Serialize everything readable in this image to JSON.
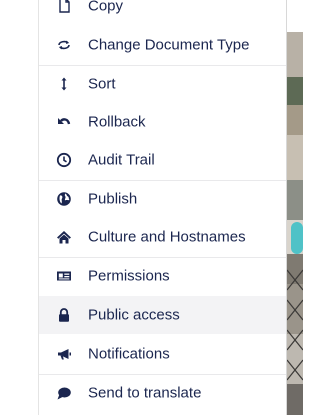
{
  "menu": {
    "items": [
      {
        "label": "Copy",
        "icon": "copy-icon"
      },
      {
        "label": "Change Document Type",
        "icon": "change-type-icon"
      },
      {
        "label": "Sort",
        "icon": "sort-icon"
      },
      {
        "label": "Rollback",
        "icon": "rollback-icon"
      },
      {
        "label": "Audit Trail",
        "icon": "audit-trail-icon"
      },
      {
        "label": "Publish",
        "icon": "globe-icon"
      },
      {
        "label": "Culture and Hostnames",
        "icon": "home-icon"
      },
      {
        "label": "Permissions",
        "icon": "id-card-icon"
      },
      {
        "label": "Public access",
        "icon": "lock-icon"
      },
      {
        "label": "Notifications",
        "icon": "megaphone-icon"
      },
      {
        "label": "Send to translate",
        "icon": "chat-bubble-icon"
      }
    ],
    "active_item": "Public access",
    "colors": {
      "text": "#1b264f",
      "icon": "#1b264f",
      "active_background": "#f3f3f5",
      "divider": "#e9e9eb"
    }
  }
}
